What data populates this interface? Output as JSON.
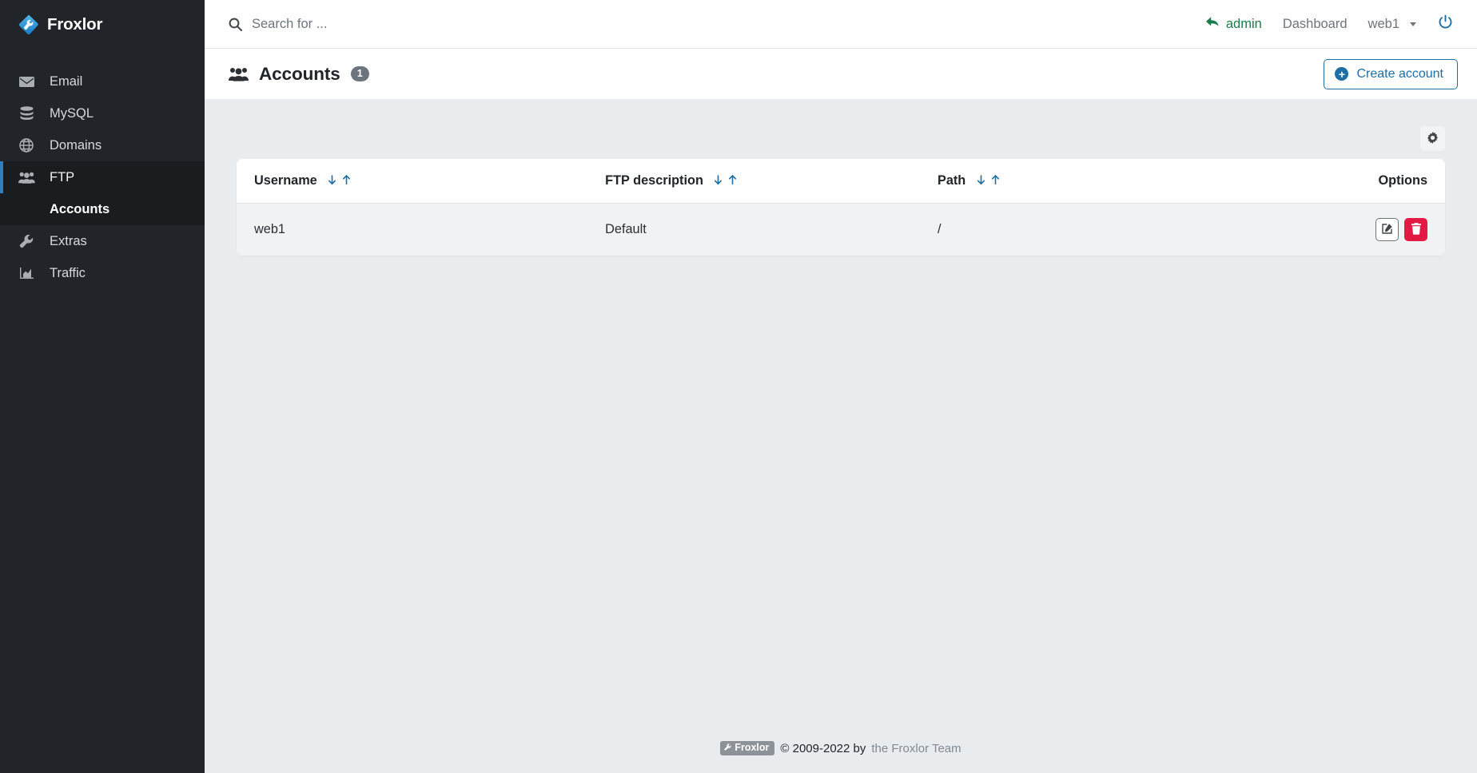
{
  "brand": {
    "name": "Froxlor",
    "logo_icon": "froxlor-wrench-logo"
  },
  "sidebar": {
    "items": [
      {
        "label": "Email",
        "icon": "envelope-icon",
        "active": false
      },
      {
        "label": "MySQL",
        "icon": "database-icon",
        "active": false
      },
      {
        "label": "Domains",
        "icon": "globe-icon",
        "active": false
      },
      {
        "label": "FTP",
        "icon": "users-icon",
        "active": true
      },
      {
        "label": "Extras",
        "icon": "wrench-icon",
        "active": false
      },
      {
        "label": "Traffic",
        "icon": "chart-bar-icon",
        "active": false
      }
    ],
    "subitem": {
      "label": "Accounts"
    }
  },
  "topbar": {
    "search": {
      "placeholder": "Search for ...",
      "value": "",
      "icon": "search-icon"
    },
    "back_icon": "back-arrow-icon",
    "admin_label": "admin",
    "dashboard_label": "Dashboard",
    "user_label": "web1",
    "power_icon": "power-icon"
  },
  "pagehead": {
    "icon": "users-icon",
    "title": "Accounts",
    "count": "1",
    "create_button": {
      "label": "Create account",
      "icon": "plus-circle-icon"
    }
  },
  "toolbar": {
    "settings_icon": "gear-icon"
  },
  "table": {
    "columns": [
      {
        "label": "Username",
        "sortable": true
      },
      {
        "label": "FTP description",
        "sortable": true
      },
      {
        "label": "Path",
        "sortable": true
      },
      {
        "label": "Options",
        "sortable": false
      }
    ],
    "sort_down_icon": "arrow-down-icon",
    "sort_up_icon": "arrow-up-icon",
    "rows": [
      {
        "username": "web1",
        "description": "Default",
        "path": "/",
        "edit_icon": "edit-pencil-icon",
        "delete_icon": "trash-icon"
      }
    ]
  },
  "footer": {
    "badge_label": "Froxlor",
    "badge_icon": "wrench-icon",
    "copyright": "© 2009-2022 by",
    "team": "the Froxlor Team"
  },
  "colors": {
    "sidebar_bg": "#212529",
    "accent_blue": "#2f7fc1",
    "link_blue": "#1c6ea4",
    "admin_green": "#1d7a4c",
    "danger_red": "#e31b44",
    "page_bg": "#e9ecef",
    "badge_gray": "#6c757d"
  }
}
